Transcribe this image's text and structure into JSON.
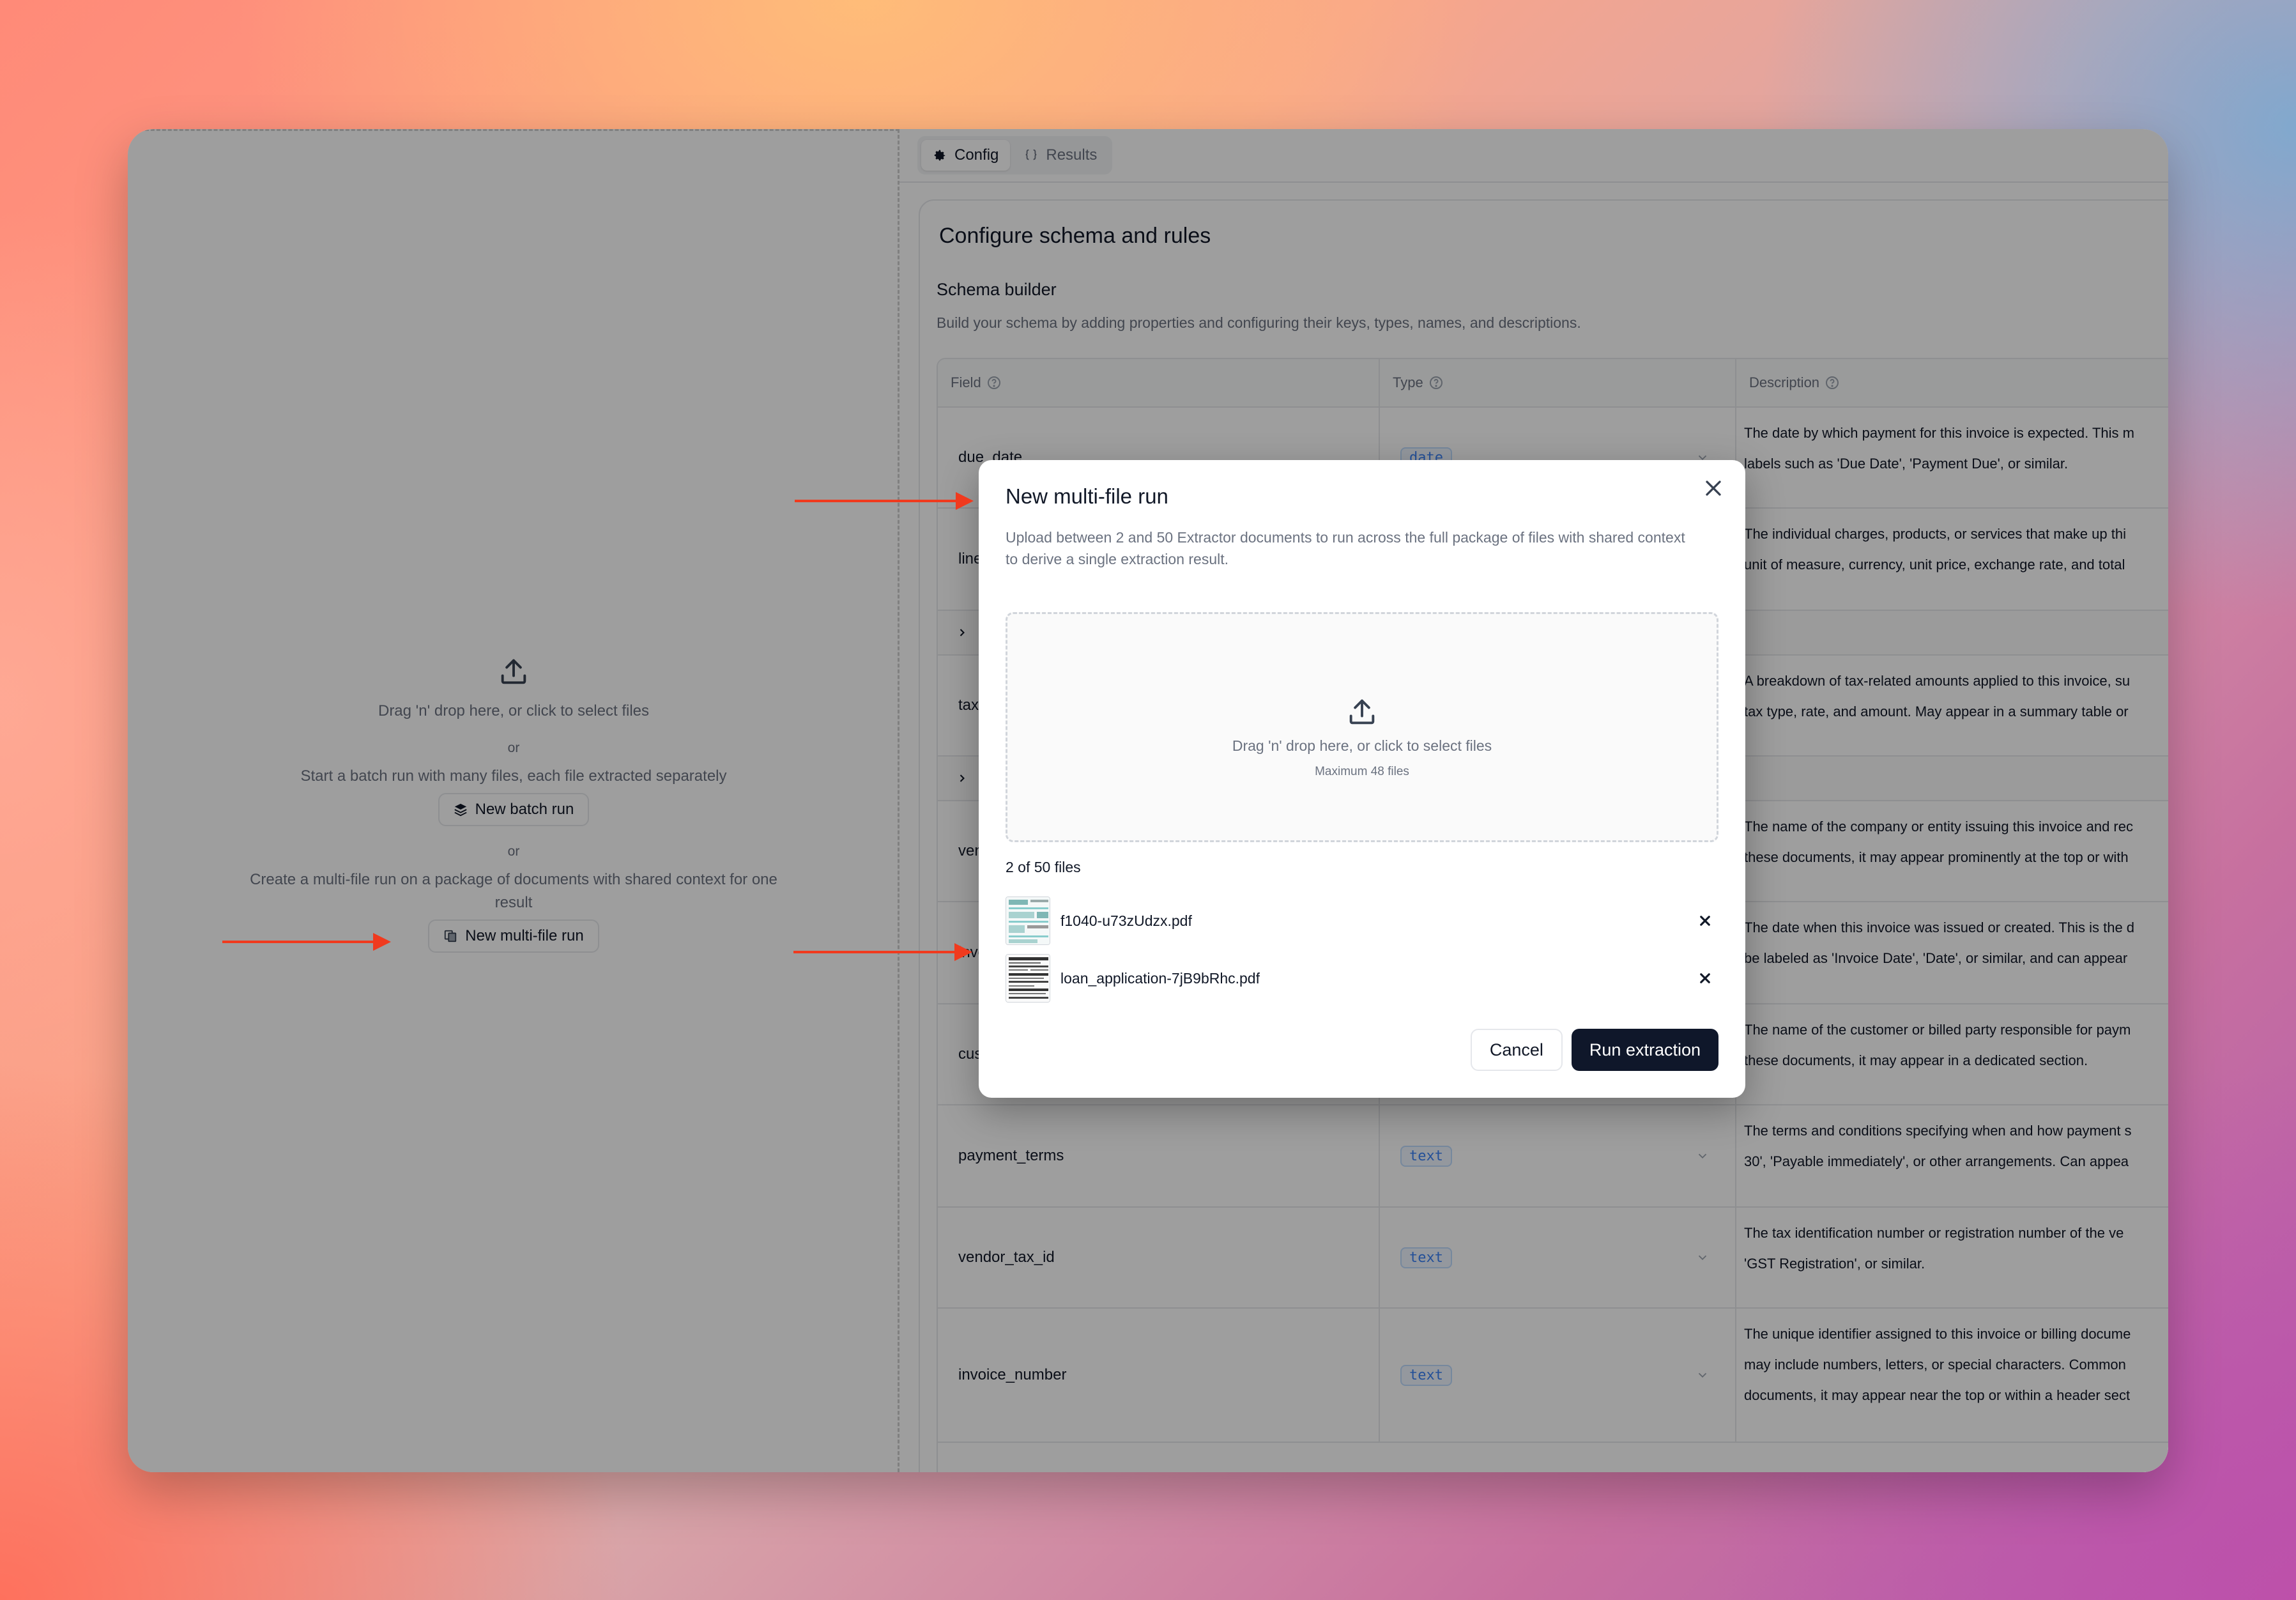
{
  "tabs": [
    {
      "label": "Config",
      "icon": "gear-icon",
      "active": true
    },
    {
      "label": "Results",
      "icon": "braces-icon",
      "active": false
    }
  ],
  "left": {
    "drop_text": "Drag 'n' drop here, or click to select files",
    "or1": "or",
    "batch_text": "Start a batch run with many files, each file extracted separately",
    "batch_button": "New batch run",
    "or2": "or",
    "multi_text": "Create a multi-file run on a package of documents with shared context for one result",
    "multi_button": "New multi-file run"
  },
  "config": {
    "title": "Configure schema and rules",
    "section_title": "Schema builder",
    "section_desc": "Build your schema by adding properties and configuring their keys, types, names, and descriptions.",
    "columns": [
      "Field",
      "Type",
      "Description"
    ],
    "rows": [
      {
        "field": "due_date",
        "type": "date",
        "desc1": "The date by which payment for this invoice is expected. This m",
        "desc2": "labels such as 'Due Date', 'Payment Due', or similar."
      },
      {
        "field": "line",
        "type": "",
        "desc1": "The individual charges, products, or services that make up thi",
        "desc2": "unit of measure, currency, unit price, exchange rate, and total"
      },
      {
        "field": "tax",
        "type": "",
        "desc1": "A breakdown of tax-related amounts applied to this invoice, su",
        "desc2": "tax type, rate, and amount. May appear in a summary table or"
      },
      {
        "field": "ven",
        "type": "",
        "desc1": "The name of the company or entity issuing this invoice and rec",
        "desc2": "these documents, it may appear prominently at the top or with"
      },
      {
        "field": "invo",
        "type": "",
        "desc1": "The date when this invoice was issued or created. This is the d",
        "desc2": "be labeled as 'Invoice Date', 'Date', or similar, and can appear"
      },
      {
        "field": "cus",
        "type": "",
        "desc1": "The name of the customer or billed party responsible for paym",
        "desc2": "these documents, it may appear in a dedicated section."
      },
      {
        "field": "payment_terms",
        "type": "text",
        "desc1": "The terms and conditions specifying when and how payment s",
        "desc2": "30', 'Payable immediately', or other arrangements. Can appea"
      },
      {
        "field": "vendor_tax_id",
        "type": "text",
        "desc1": "The tax identification number or registration number of the ve",
        "desc2": "'GST Registration', or similar."
      },
      {
        "field": "invoice_number",
        "type": "text",
        "desc1": "The unique identifier assigned to this invoice or billing docume",
        "desc2": "may include numbers, letters, or special characters. Common",
        "desc3": "documents, it may appear near the top or within a header sect"
      }
    ]
  },
  "modal": {
    "title": "New multi-file run",
    "description": "Upload between 2 and 50 Extractor documents to run across the full package of files with shared context to derive a single extraction result.",
    "drop_text": "Drag 'n' drop here, or click to select files",
    "max_text": "Maximum 48 files",
    "file_count": "2 of 50 files",
    "files": [
      {
        "name": "f1040-u73zUdzx.pdf"
      },
      {
        "name": "loan_application-7jB9bRhc.pdf"
      }
    ],
    "cancel_label": "Cancel",
    "run_label": "Run extraction"
  },
  "colors": {
    "annotation_arrow": "#f03a1e",
    "primary_button": "#0f172a",
    "type_badge": "#3b82f6"
  }
}
